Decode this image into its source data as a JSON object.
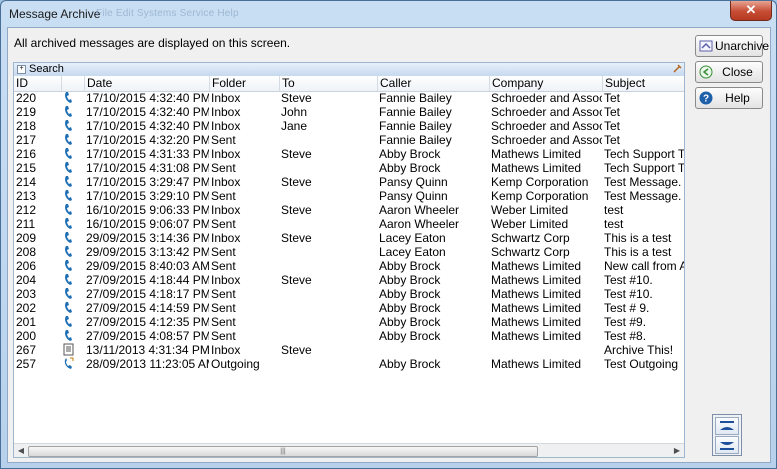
{
  "window": {
    "title": "Message Archive",
    "ghost_menu": "File   Edit   Systems Service   Help",
    "close_glyph": "✕"
  },
  "info_text": "All archived messages are displayed on this screen.",
  "search": {
    "label": "Search",
    "expand_glyph": "+"
  },
  "columns": {
    "id": "ID",
    "date": "Date",
    "folder": "Folder",
    "to": "To",
    "caller": "Caller",
    "company": "Company",
    "subject": "Subject"
  },
  "rows": [
    {
      "id": "220",
      "icon": "phone",
      "date": "17/10/2015 4:32:40 PM",
      "folder": "Inbox",
      "to": "Steve",
      "caller": "Fannie Bailey",
      "company": "Schroeder and Associ...",
      "subject": "Tet"
    },
    {
      "id": "219",
      "icon": "phone",
      "date": "17/10/2015 4:32:40 PM",
      "folder": "Inbox",
      "to": "John",
      "caller": "Fannie Bailey",
      "company": "Schroeder and Associ...",
      "subject": "Tet"
    },
    {
      "id": "218",
      "icon": "phone",
      "date": "17/10/2015 4:32:40 PM",
      "folder": "Inbox",
      "to": "Jane",
      "caller": "Fannie Bailey",
      "company": "Schroeder and Associ...",
      "subject": "Tet"
    },
    {
      "id": "217",
      "icon": "phone",
      "date": "17/10/2015 4:32:20 PM",
      "folder": "Sent",
      "to": "",
      "caller": "Fannie Bailey",
      "company": "Schroeder and Associ...",
      "subject": "Tet"
    },
    {
      "id": "216",
      "icon": "phone",
      "date": "17/10/2015 4:31:33 PM",
      "folder": "Inbox",
      "to": "Steve",
      "caller": "Abby Brock",
      "company": "Mathews Limited",
      "subject": "Tech Support Test"
    },
    {
      "id": "215",
      "icon": "phone",
      "date": "17/10/2015 4:31:08 PM",
      "folder": "Sent",
      "to": "",
      "caller": "Abby Brock",
      "company": "Mathews Limited",
      "subject": "Tech Support Test"
    },
    {
      "id": "214",
      "icon": "phone",
      "date": "17/10/2015 3:29:47 PM",
      "folder": "Inbox",
      "to": "Steve",
      "caller": "Pansy Quinn",
      "company": "Kemp Corporation",
      "subject": "Test Message."
    },
    {
      "id": "213",
      "icon": "phone",
      "date": "17/10/2015 3:29:10 PM",
      "folder": "Sent",
      "to": "",
      "caller": "Pansy Quinn",
      "company": "Kemp Corporation",
      "subject": "Test Message."
    },
    {
      "id": "212",
      "icon": "phone",
      "date": "16/10/2015 9:06:33 PM",
      "folder": "Inbox",
      "to": "Steve",
      "caller": "Aaron Wheeler",
      "company": "Weber Limited",
      "subject": "test"
    },
    {
      "id": "211",
      "icon": "phone",
      "date": "16/10/2015 9:06:07 PM",
      "folder": "Sent",
      "to": "",
      "caller": "Aaron Wheeler",
      "company": "Weber Limited",
      "subject": "test"
    },
    {
      "id": "209",
      "icon": "phone",
      "date": "29/09/2015 3:14:36 PM",
      "folder": "Inbox",
      "to": "Steve",
      "caller": "Lacey Eaton",
      "company": "Schwartz Corp",
      "subject": "This is a test"
    },
    {
      "id": "208",
      "icon": "phone",
      "date": "29/09/2015 3:13:42 PM",
      "folder": "Sent",
      "to": "",
      "caller": "Lacey Eaton",
      "company": "Schwartz Corp",
      "subject": "This is a test"
    },
    {
      "id": "206",
      "icon": "phone",
      "date": "29/09/2015 8:40:03 AM",
      "folder": "Sent",
      "to": "",
      "caller": "Abby Brock",
      "company": "Mathews Limited",
      "subject": "New call from Abby"
    },
    {
      "id": "204",
      "icon": "phone",
      "date": "27/09/2015 4:18:44 PM",
      "folder": "Inbox",
      "to": "Steve",
      "caller": "Abby Brock",
      "company": "Mathews Limited",
      "subject": "Test #10."
    },
    {
      "id": "203",
      "icon": "phone",
      "date": "27/09/2015 4:18:17 PM",
      "folder": "Sent",
      "to": "",
      "caller": "Abby Brock",
      "company": "Mathews Limited",
      "subject": "Test #10."
    },
    {
      "id": "202",
      "icon": "phone",
      "date": "27/09/2015 4:14:59 PM",
      "folder": "Sent",
      "to": "",
      "caller": "Abby Brock",
      "company": "Mathews Limited",
      "subject": "Test # 9."
    },
    {
      "id": "201",
      "icon": "phone",
      "date": "27/09/2015 4:12:35 PM",
      "folder": "Sent",
      "to": "",
      "caller": "Abby Brock",
      "company": "Mathews Limited",
      "subject": "Test #9."
    },
    {
      "id": "200",
      "icon": "phone",
      "date": "27/09/2015 4:08:57 PM",
      "folder": "Sent",
      "to": "",
      "caller": "Abby Brock",
      "company": "Mathews Limited",
      "subject": "Test #8."
    },
    {
      "id": "267",
      "icon": "note",
      "date": "13/11/2013 4:31:34 PM",
      "folder": "Inbox",
      "to": "Steve",
      "caller": "",
      "company": "",
      "subject": "Archive This!"
    },
    {
      "id": "257",
      "icon": "phone-out",
      "date": "28/09/2013 11:23:05 AM",
      "folder": "Outgoing",
      "to": "",
      "caller": "Abby Brock",
      "company": "Mathews Limited",
      "subject": "Test Outgoing"
    }
  ],
  "buttons": {
    "unarchive": "Unarchive",
    "close": "Close",
    "help": "Help"
  },
  "icons": {
    "unarchive": "unarchive-icon",
    "close": "close-circle-icon",
    "help": "help-icon"
  },
  "colors": {
    "phone": "#1f6fb5",
    "help": "#1d5fa8",
    "close_button": "#c74c34"
  }
}
